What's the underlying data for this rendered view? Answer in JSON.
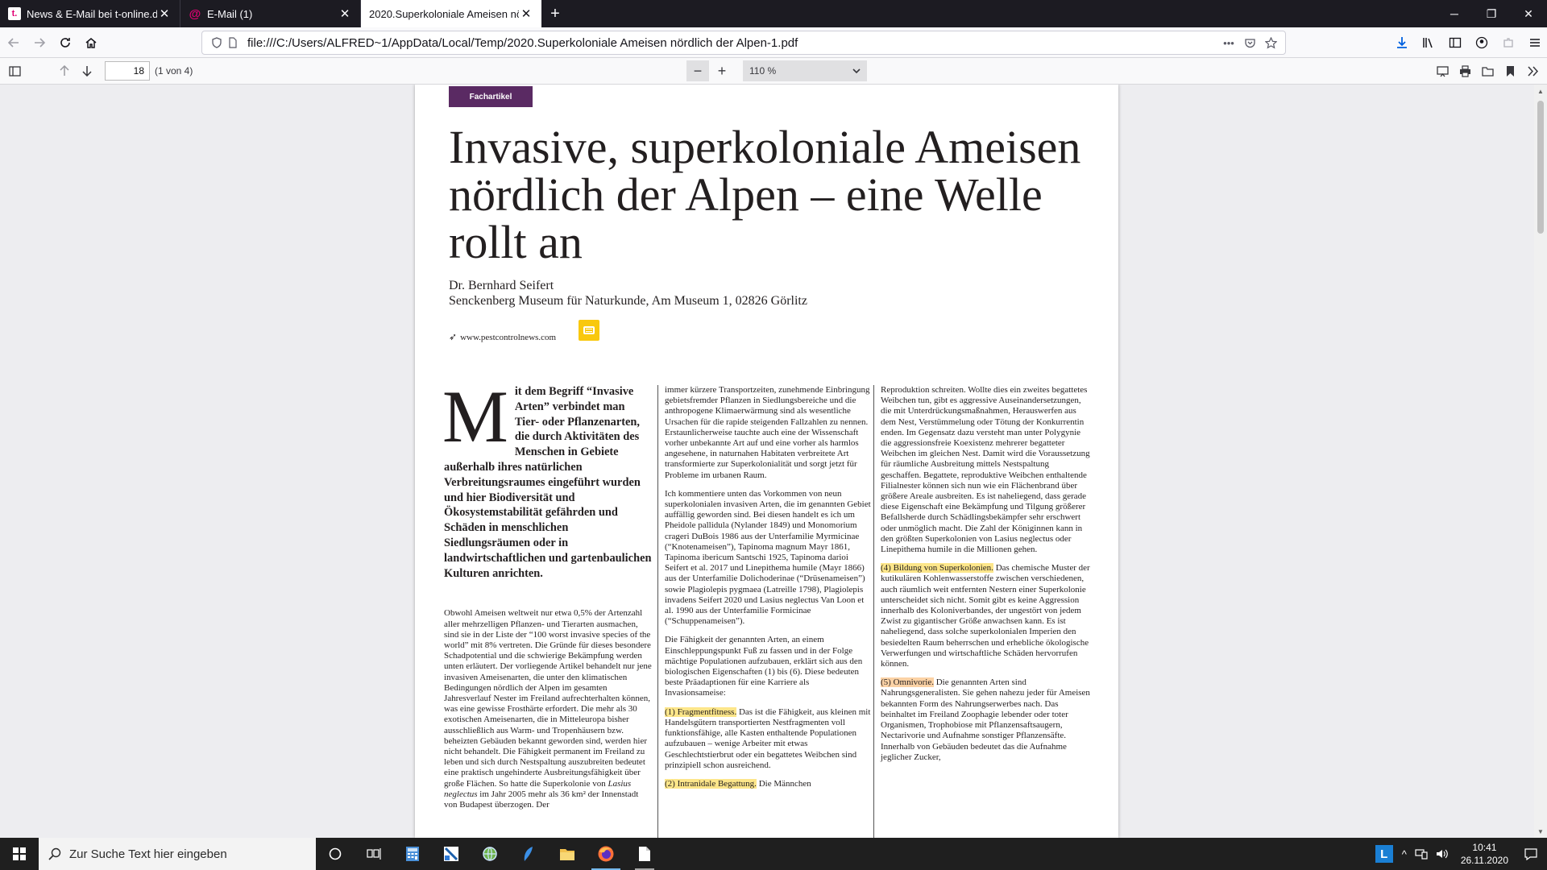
{
  "tabs": [
    {
      "title": "News & E-Mail bei t-online.d",
      "favicon": "t"
    },
    {
      "title": "E-Mail (1)",
      "favicon": "@"
    },
    {
      "title": "2020.Superkoloniale Ameisen nö",
      "favicon": "pdf"
    }
  ],
  "window": {
    "minimize": "─",
    "maximize": "❐",
    "close": "✕"
  },
  "nav": {
    "url": "file:///C:/Users/ALFRED~1/AppData/Local/Temp/2020.Superkoloniale Ameisen nördlich der Alpen-1.pdf"
  },
  "pdf_toolbar": {
    "page_number": "18",
    "page_count": "(1 von 4)",
    "zoom_out": "−",
    "zoom_in": "+",
    "zoom_level": "110 %"
  },
  "document": {
    "category": "Fachartikel",
    "title": "Invasive, superkoloniale Ameisen nördlich der Alpen – eine Welle rollt an",
    "author": "Dr. Bernhard Seifert",
    "affiliation": "Senckenberg Museum für Naturkunde, Am Museum 1, 02826 Görlitz",
    "website": "www.pestcontrolnews.com",
    "dropcap": "M",
    "lead_rest": "it dem Begriff “Invasive Arten” verbindet man Tier- oder Pflanzenarten, die durch Aktivitäten des Menschen in Gebiete außerhalb ihres natürlichen Verbreitungsraumes eingeführt wurden und hier Biodiversität und Ökosystemstabilität gefährden und Schäden in menschlichen Siedlungsräumen oder in landwirtschaftlichen und gartenbaulichen Kulturen anrichten.",
    "col1_para": "Obwohl Ameisen weltweit nur etwa 0,5% der Artenzahl aller mehrzelligen Pflanzen- und Tierarten ausmachen, sind sie in der Liste der “100 worst invasive species of the world” mit 8% vertreten. Die Gründe für dieses besondere Schadpotential und die schwierige Bekämpfung werden unten erläutert. Der vorliegende Artikel behandelt nur jene invasiven Ameisenarten, die unter den klimatischen Bedingungen nördlich der Alpen im gesamten Jahresverlauf Nester im Freiland aufrechterhalten können, was eine gewisse Frosthärte erfordert. Die mehr als 30 exotischen Ameisenarten, die in Mitteleuropa bisher ausschließlich aus Warm- und Tropenhäusern bzw. beheizten Gebäuden bekannt geworden sind, werden hier nicht behandelt. Die Fähigkeit permanent im Freiland zu leben und sich durch Nestspaltung auszubreiten bedeutet eine praktisch ungehinderte Ausbreitungsfähigkeit über große Flächen. So hatte die Superkolonie von",
    "col1_tail_species": "Lasius neglectus",
    "col1_tail": " im Jahr 2005 mehr als 36 km² der Innenstadt von Budapest überzogen. Der",
    "col2_para1": "immer kürzere Transportzeiten, zunehmende Einbringung gebietsfremder Pflanzen in Siedlungsbereiche und die anthropogene Klimaerwärmung sind als wesentliche Ursachen für die rapide steigenden Fallzahlen zu nennen. Erstaunlicherweise tauchte auch eine der Wissenschaft vorher unbekannte Art auf und eine vorher als harmlos angesehene, in naturnahen Habitaten verbreitete Art transformierte zur Superkolonialität und sorgt jetzt für Probleme im urbanen Raum.",
    "col2_para2": "Ich kommentiere unten das Vorkommen von neun superkolonialen invasiven Arten, die im genannten Gebiet auffällig geworden sind. Bei diesen handelt es ich um Pheidole pallidula (Nylander 1849) und Monomorium crageri DuBois 1986 aus der Unterfamilie Myrmicinae (“Knotenameisen”), Tapinoma magnum Mayr 1861, Tapinoma ibericum Santschi 1925, Tapinoma darioi Seifert et al. 2017 und Linepithema humile (Mayr 1866) aus der Unterfamilie Dolichoderinae (“Drüsenameisen”) sowie Plagiolepis pygmaea (Latreille 1798), Plagiolepis invadens Seifert 2020 und Lasius neglectus Van Loon et al. 1990 aus der Unterfamilie Formicinae (“Schuppenameisen”).",
    "col2_para3": "Die Fähigkeit der genannten Arten, an einem Einschleppungspunkt Fuß zu fassen und in der Folge mächtige Populationen aufzubauen, erklärt sich aus den biologischen Eigenschaften (1) bis (6). Diese bedeuten beste Präadaptionen für eine Karriere als Invasionsameise:",
    "col2_hl1": "(1) Fragmentfitness.",
    "col2_para4": " Das ist die Fähigkeit, aus kleinen mit Handelsgütern transportierten Nestfragmenten voll funktionsfähige, alle Kasten enthaltende Populationen aufzubauen – wenige Arbeiter mit etwas Geschlechtstierbrut oder ein begattetes Weibchen sind prinzipiell schon ausreichend.",
    "col2_hl2": "(2) Intranidale Begattung.",
    "col2_para5": " Die Männchen",
    "col3_para1": "Reproduktion schreiten. Wollte dies ein zweites begattetes Weibchen tun, gibt es aggressive Auseinandersetzungen, die mit Unterdrückungsmaßnahmen, Herauswerfen aus dem Nest, Verstümmelung oder Tötung der Konkurrentin enden. Im Gegensatz dazu versteht man unter Polygynie die aggressionsfreie Koexistenz mehrerer begatteter Weibchen im gleichen Nest. Damit wird die Voraussetzung für räumliche Ausbreitung mittels Nestspaltung geschaffen. Begattete, reproduktive Weibchen enthaltende Filialnester können sich nun wie ein Flächenbrand über größere Areale ausbreiten. Es ist naheliegend, dass gerade diese Eigenschaft eine Bekämpfung und Tilgung größerer Befallsherde durch Schädlingsbekämpfer sehr erschwert oder unmöglich macht. Die Zahl der Königinnen kann in den größten Superkolonien von Lasius neglectus oder Linepithema humile in die Millionen gehen.",
    "col3_hl1": "(4) Bildung von Superkolonien.",
    "col3_para2": " Das chemische Muster der kutikulären Kohlenwasserstoffe zwischen verschiedenen, auch räumlich weit entfernten Nestern einer Superkolonie unterscheidet sich nicht. Somit gibt es keine Aggression innerhalb des Koloniverbandes, der ungestört von jedem Zwist zu gigantischer Größe anwachsen kann. Es ist naheliegend, dass solche superkolonialen Imperien den besiedelten Raum beherrschen und erhebliche ökologische Verwerfungen und wirtschaftliche Schäden hervorrufen können.",
    "col3_hl2": "(5) Omnivorie.",
    "col3_para3": " Die genannten Arten sind Nahrungsgeneralisten. Sie gehen nahezu jeder für Ameisen bekannten Form des Nahrungserwerbes nach. Das beinhaltet im Freiland Zoophagie lebender oder toter Organismen, Trophobiose mit Pflanzensaftsaugern, Nectarivorie und Aufnahme sonstiger Pflanzensäfte. Innerhalb von Gebäuden bedeutet das die Aufnahme jeglicher Zucker,"
  },
  "taskbar": {
    "search_placeholder": "Zur Suche Text hier eingeben",
    "time": "10:41",
    "date": "26.11.2020"
  }
}
